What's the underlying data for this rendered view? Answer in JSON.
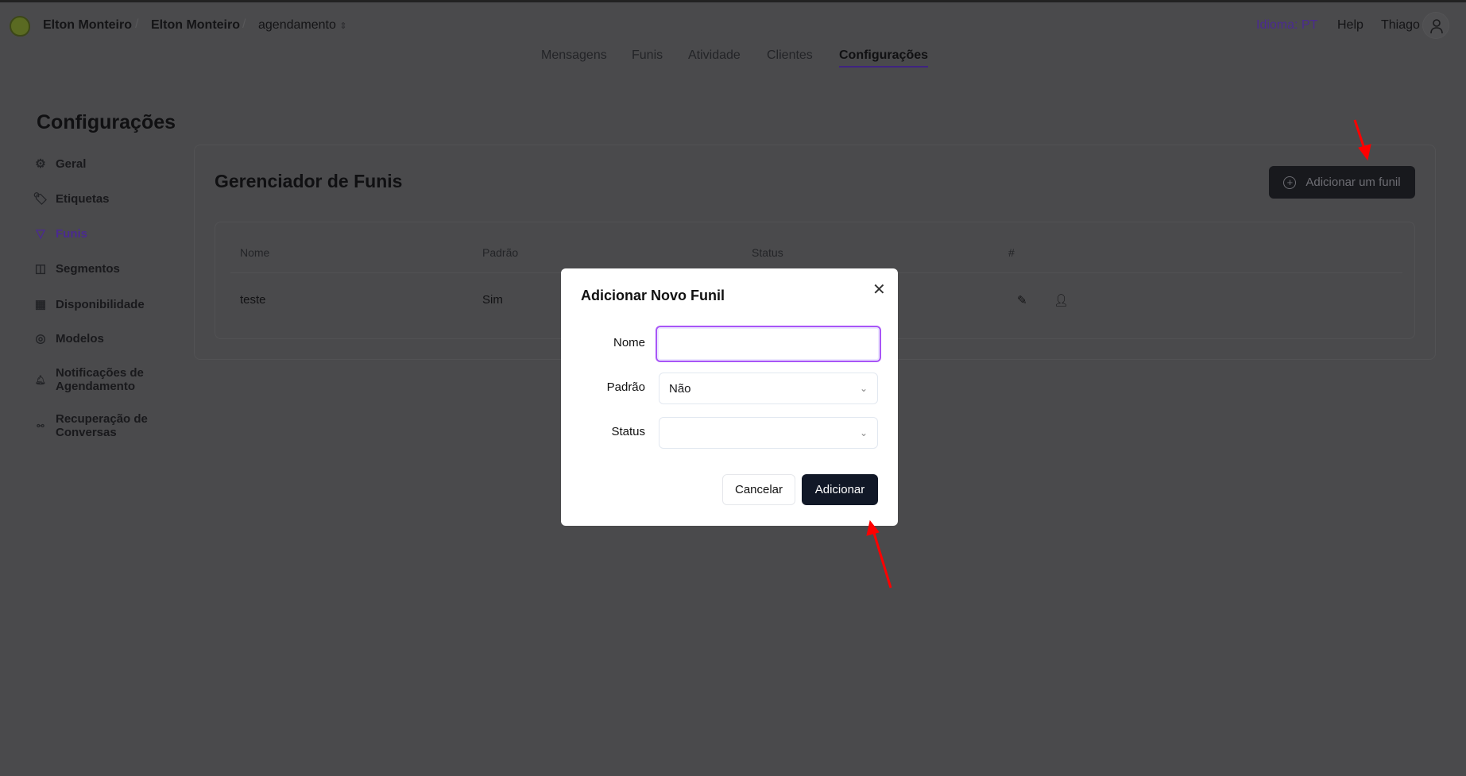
{
  "header": {
    "breadcrumbs": [
      "Elton Monteiro",
      "Elton Monteiro",
      "agendamento"
    ],
    "language": "Idioma: PT",
    "help": "Help",
    "user": "Thiago"
  },
  "nav": {
    "tabs": [
      "Mensagens",
      "Funis",
      "Atividade",
      "Clientes",
      "Configurações"
    ],
    "active": "Configurações"
  },
  "page": {
    "title": "Configurações"
  },
  "sidebar": {
    "items": [
      {
        "label": "Geral",
        "icon": "gear-icon"
      },
      {
        "label": "Etiquetas",
        "icon": "tags-icon"
      },
      {
        "label": "Funis",
        "icon": "filter-icon"
      },
      {
        "label": "Segmentos",
        "icon": "layout-icon"
      },
      {
        "label": "Disponibilidade",
        "icon": "calendar-icon"
      },
      {
        "label": "Modelos",
        "icon": "templates-icon"
      },
      {
        "label": "Notificações de Agendamento",
        "icon": "bell-icon"
      },
      {
        "label": "Recuperação de Conversas",
        "icon": "route-icon"
      }
    ],
    "active": "Funis"
  },
  "manager": {
    "title": "Gerenciador de Funis",
    "add_button": "Adicionar um funil",
    "columns": [
      "Nome",
      "Padrão",
      "Status",
      "#"
    ],
    "rows": [
      {
        "nome": "teste",
        "padrao": "Sim",
        "status": ""
      }
    ]
  },
  "modal": {
    "title": "Adicionar Novo Funil",
    "fields": {
      "nome_label": "Nome",
      "nome_value": "",
      "padrao_label": "Padrão",
      "padrao_value": "Não",
      "status_label": "Status",
      "status_value": ""
    },
    "cancel": "Cancelar",
    "submit": "Adicionar"
  },
  "colors": {
    "accent": "#7c3aed",
    "primary": "#111827",
    "annotation": "#ff0000"
  }
}
